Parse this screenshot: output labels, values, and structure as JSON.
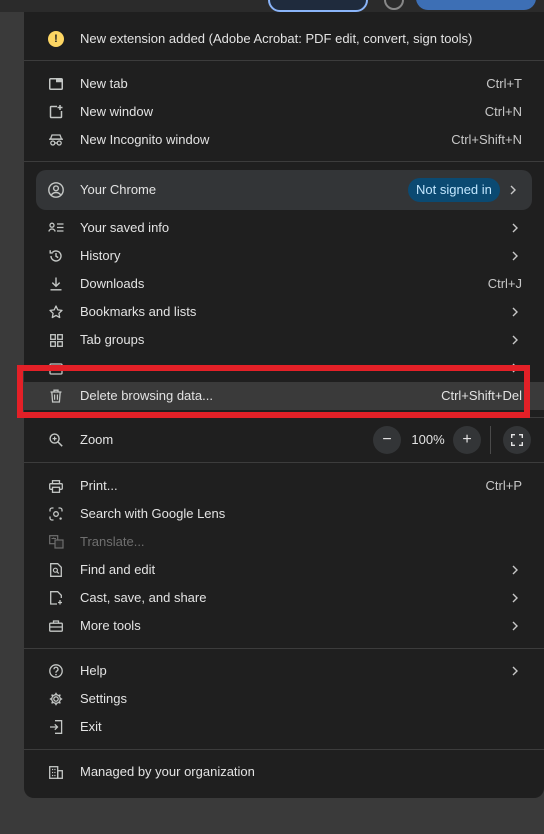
{
  "notification": {
    "label": "New extension added (Adobe Acrobat: PDF edit, convert, sign tools)",
    "icon": "info-icon"
  },
  "section1": [
    {
      "label": "New tab",
      "shortcut": "Ctrl+T",
      "icon": "new-tab-icon"
    },
    {
      "label": "New window",
      "shortcut": "Ctrl+N",
      "icon": "new-window-icon"
    },
    {
      "label": "New Incognito window",
      "shortcut": "Ctrl+Shift+N",
      "icon": "incognito-icon"
    }
  ],
  "profile": {
    "label": "Your Chrome",
    "badge": "Not signed in",
    "icon": "account-icon"
  },
  "section2": [
    {
      "label": "Your saved info",
      "icon": "saved-info-icon"
    },
    {
      "label": "History",
      "icon": "history-icon"
    },
    {
      "label": "Downloads",
      "shortcut": "Ctrl+J",
      "icon": "download-icon"
    },
    {
      "label": "Bookmarks and lists",
      "icon": "star-icon"
    },
    {
      "label": "Tab groups",
      "icon": "tab-groups-icon"
    },
    {
      "label": "Delete browsing data...",
      "shortcut": "Ctrl+Shift+Del",
      "icon": "trash-icon"
    }
  ],
  "zoom": {
    "label": "Zoom",
    "value": "100%",
    "minus": "−",
    "plus": "+",
    "icon": "zoom-icon"
  },
  "section3": [
    {
      "label": "Print...",
      "shortcut": "Ctrl+P",
      "icon": "print-icon"
    },
    {
      "label": "Search with Google Lens",
      "icon": "lens-icon"
    },
    {
      "label": "Translate...",
      "icon": "translate-icon"
    },
    {
      "label": "Find and edit",
      "icon": "find-icon"
    },
    {
      "label": "Cast, save, and share",
      "icon": "cast-save-icon"
    },
    {
      "label": "More tools",
      "icon": "toolbox-icon"
    }
  ],
  "section4": [
    {
      "label": "Help",
      "icon": "help-icon"
    },
    {
      "label": "Settings",
      "icon": "gear-icon"
    },
    {
      "label": "Exit",
      "icon": "exit-icon"
    }
  ],
  "managed": {
    "label": "Managed by your organization",
    "icon": "building-icon"
  },
  "colors": {
    "menu_bg": "#1f1f1f",
    "badge_bg": "#0b4a72",
    "highlight_border": "#e32027",
    "notice": "#fdd663"
  }
}
